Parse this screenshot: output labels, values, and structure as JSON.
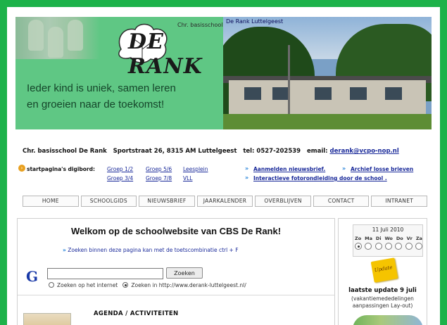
{
  "banner": {
    "school_small": "Chr. basisschool",
    "logo": "DE RANK",
    "slogan_line1": "Ieder kind is uniek, samen leren",
    "slogan_line2": "en groeien naar de toekomst!",
    "photo_title": "De Rank  Luttelgeest"
  },
  "address": {
    "name": "Chr. basisschool De Rank",
    "street": "Sportstraat 26, 8315 AM Luttelgeest",
    "tel": "tel: 0527-202539",
    "email_label": "email:",
    "email": "derank@vcpo-nop.nl"
  },
  "quicklinks": {
    "label": "startpagina's digibord:",
    "groups": [
      "Groep 1/2",
      "Groep 5/6",
      "Leesplein",
      "Groep 3/4",
      "Groep 7/8",
      "VLL"
    ],
    "right": [
      "Aanmelden nieuwsbrief.",
      "Archief losse brieven",
      "Interactieve fotorondleiding door de school ."
    ]
  },
  "nav": [
    "HOME",
    "SCHOOLGIDS",
    "NIEUWSBRIEF",
    "JAARKALENDER",
    "OVERBLIJVEN",
    "CONTACT",
    "INTRANET"
  ],
  "main": {
    "welcome": "Welkom op de schoolwebsite van CBS De Rank!",
    "search_tip_arrow": "»",
    "search_tip": "Zoeken binnen deze pagina kan met de toetscombinatie ctrl + F",
    "search": {
      "logo": "G",
      "value": "",
      "button": "Zoeken",
      "option_internet": "Zoeken op het internet",
      "option_site": "Zoeken in http://www.derank-luttelgeest.nl/"
    },
    "agenda_title": "AGENDA / ACTIVITEITEN"
  },
  "side": {
    "calendar_date": "11 Juli 2010",
    "days": [
      "Zo",
      "Ma",
      "Di",
      "Wo",
      "Do",
      "Vr",
      "Za"
    ],
    "selected_day_index": 0,
    "note_icon_text": "Update",
    "update_title": "laatste update 9 juli",
    "update_line1": "(vakantiemededelingen",
    "update_line2": "aanpassingen Lay-out)"
  },
  "colors": {
    "frame_green": "#1db24a",
    "banner_green": "#5fc784",
    "link_blue": "#1a2a9a"
  }
}
